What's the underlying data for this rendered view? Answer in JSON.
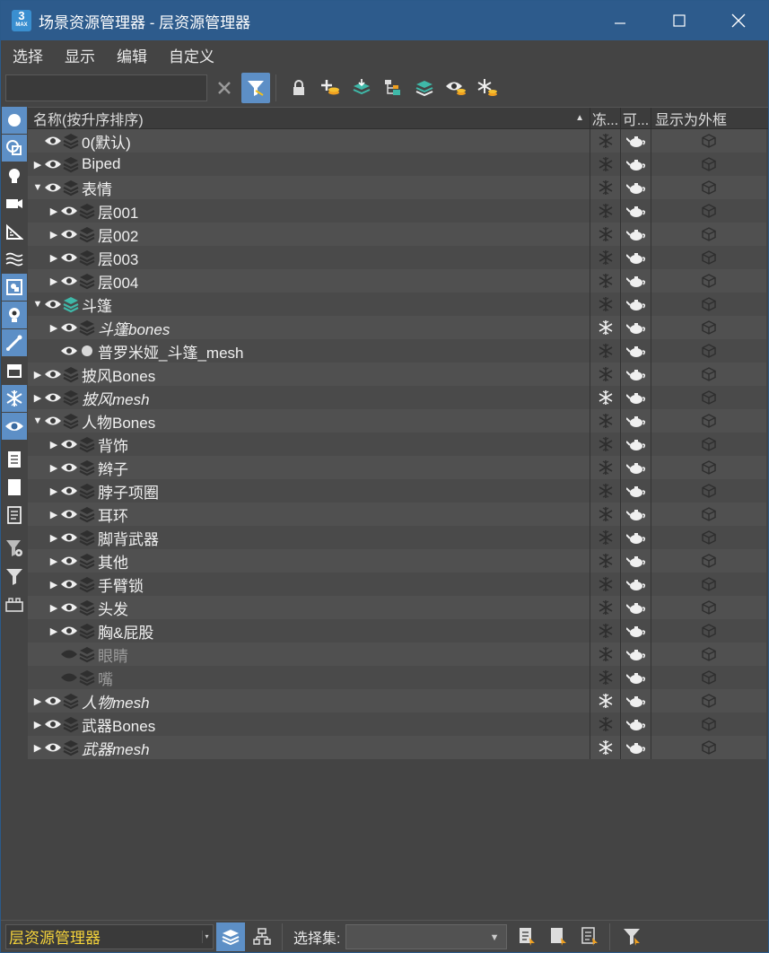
{
  "window": {
    "app_icon_number": "3",
    "app_icon_text": "MAX",
    "title": "场景资源管理器 - 层资源管理器",
    "minimize": "－",
    "maximize": "☐",
    "close": "✕"
  },
  "menu": [
    "选择",
    "显示",
    "编辑",
    "自定义"
  ],
  "toolbar": {
    "search_value": "",
    "clear_glyph": "✕"
  },
  "header": {
    "name": "名称(按升序排序)",
    "sort_indicator": "▲",
    "freeze": "冻...",
    "render": "可...",
    "box": "显示为外框"
  },
  "rows": [
    {
      "name": "0(默认)",
      "level": 0,
      "expander": "",
      "italic": false,
      "dim": false,
      "icon": "layer-dark",
      "eye": "visible"
    },
    {
      "name": "Biped",
      "level": 0,
      "expander": "▶",
      "italic": false,
      "dim": false,
      "icon": "layer-dark",
      "eye": "visible"
    },
    {
      "name": "表情",
      "level": 0,
      "expander": "▼",
      "italic": false,
      "dim": false,
      "icon": "layer-dark",
      "eye": "visible"
    },
    {
      "name": "层001",
      "level": 1,
      "expander": "▶",
      "italic": false,
      "dim": false,
      "icon": "layer-dark",
      "eye": "visible"
    },
    {
      "name": "层002",
      "level": 1,
      "expander": "▶",
      "italic": false,
      "dim": false,
      "icon": "layer-dark",
      "eye": "visible"
    },
    {
      "name": "层003",
      "level": 1,
      "expander": "▶",
      "italic": false,
      "dim": false,
      "icon": "layer-dark",
      "eye": "visible"
    },
    {
      "name": "层004",
      "level": 1,
      "expander": "▶",
      "italic": false,
      "dim": false,
      "icon": "layer-dark",
      "eye": "visible"
    },
    {
      "name": "斗篷",
      "level": 0,
      "expander": "▼",
      "italic": false,
      "dim": false,
      "icon": "layer-teal",
      "eye": "visible"
    },
    {
      "name": "斗篷bones",
      "level": 1,
      "expander": "▶",
      "italic": true,
      "dim": false,
      "icon": "layer-dark",
      "eye": "visible"
    },
    {
      "name": "普罗米娅_斗篷_mesh",
      "level": 1,
      "expander": "",
      "italic": false,
      "dim": false,
      "icon": "object-dot",
      "eye": "visible"
    },
    {
      "name": "披风Bones",
      "level": 0,
      "expander": "▶",
      "italic": false,
      "dim": false,
      "icon": "layer-dark",
      "eye": "visible"
    },
    {
      "name": "披风mesh",
      "level": 0,
      "expander": "▶",
      "italic": true,
      "dim": false,
      "icon": "layer-dark",
      "eye": "visible"
    },
    {
      "name": "人物Bones",
      "level": 0,
      "expander": "▼",
      "italic": false,
      "dim": false,
      "icon": "layer-dark",
      "eye": "visible"
    },
    {
      "name": "背饰",
      "level": 1,
      "expander": "▶",
      "italic": false,
      "dim": false,
      "icon": "layer-dark",
      "eye": "visible"
    },
    {
      "name": "辫子",
      "level": 1,
      "expander": "▶",
      "italic": false,
      "dim": false,
      "icon": "layer-dark",
      "eye": "visible"
    },
    {
      "name": "脖子项圈",
      "level": 1,
      "expander": "▶",
      "italic": false,
      "dim": false,
      "icon": "layer-dark",
      "eye": "visible"
    },
    {
      "name": "耳环",
      "level": 1,
      "expander": "▶",
      "italic": false,
      "dim": false,
      "icon": "layer-dark",
      "eye": "visible"
    },
    {
      "name": "脚背武器",
      "level": 1,
      "expander": "▶",
      "italic": false,
      "dim": false,
      "icon": "layer-dark",
      "eye": "visible"
    },
    {
      "name": "其他",
      "level": 1,
      "expander": "▶",
      "italic": false,
      "dim": false,
      "icon": "layer-dark",
      "eye": "visible"
    },
    {
      "name": "手臂锁",
      "level": 1,
      "expander": "▶",
      "italic": false,
      "dim": false,
      "icon": "layer-dark",
      "eye": "visible"
    },
    {
      "name": "头发",
      "level": 1,
      "expander": "▶",
      "italic": false,
      "dim": false,
      "icon": "layer-dark",
      "eye": "visible"
    },
    {
      "name": "胸&屁股",
      "level": 1,
      "expander": "▶",
      "italic": false,
      "dim": false,
      "icon": "layer-dark",
      "eye": "visible"
    },
    {
      "name": "眼睛",
      "level": 1,
      "expander": "",
      "italic": false,
      "dim": true,
      "icon": "layer-dark",
      "eye": "hidden"
    },
    {
      "name": "嘴",
      "level": 1,
      "expander": "",
      "italic": false,
      "dim": true,
      "icon": "layer-dark",
      "eye": "hidden"
    },
    {
      "name": "人物mesh",
      "level": 0,
      "expander": "▶",
      "italic": true,
      "dim": false,
      "icon": "layer-dark",
      "eye": "visible"
    },
    {
      "name": "武器Bones",
      "level": 0,
      "expander": "▶",
      "italic": false,
      "dim": false,
      "icon": "layer-dark",
      "eye": "visible"
    },
    {
      "name": "武器mesh",
      "level": 0,
      "expander": "▶",
      "italic": true,
      "dim": false,
      "icon": "layer-dark",
      "eye": "visible"
    }
  ],
  "bottom": {
    "manager_select": "层资源管理器",
    "selection_set_label": "选择集:",
    "selection_set_value": ""
  },
  "colors": {
    "titlebar": "#2d5b8c",
    "active_button": "#5d8fc6",
    "teal_layer": "#3fb8a8",
    "manager_text": "#f5d33a"
  }
}
